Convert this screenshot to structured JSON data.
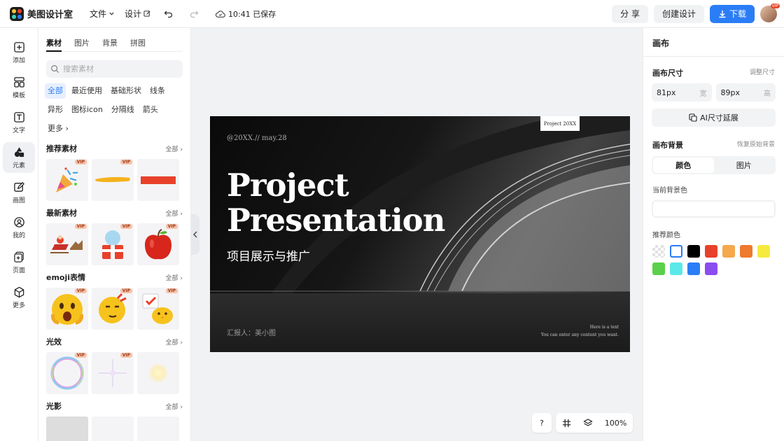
{
  "app": {
    "name": "美图设计室"
  },
  "topbar": {
    "file_label": "文件",
    "design_label": "设计",
    "save_status": "10:41 已保存",
    "share_label": "分 享",
    "create_label": "创建设计",
    "download_label": "下载",
    "avatar_badge": "VIP"
  },
  "leftnav": {
    "items": [
      {
        "label": "添加",
        "icon": "plus-square-icon"
      },
      {
        "label": "模板",
        "icon": "layout-icon"
      },
      {
        "label": "文字",
        "icon": "text-icon"
      },
      {
        "label": "元素",
        "icon": "shapes-icon"
      },
      {
        "label": "画图",
        "icon": "pencil-icon"
      },
      {
        "label": "我的",
        "icon": "user-icon"
      },
      {
        "label": "页面",
        "icon": "page-add-icon"
      },
      {
        "label": "更多",
        "icon": "cube-icon"
      }
    ],
    "active_index": 3
  },
  "panel": {
    "tabs": [
      "素材",
      "图片",
      "背景",
      "拼图"
    ],
    "active_tab": 0,
    "search_placeholder": "搜索素材",
    "chips": [
      "全部",
      "最近使用",
      "基础形状",
      "线条",
      "异形",
      "图标icon",
      "分隔线",
      "箭头",
      "更多"
    ],
    "active_chip": 0,
    "sections": [
      {
        "title": "推荐素材",
        "all": "全部"
      },
      {
        "title": "最新素材",
        "all": "全部"
      },
      {
        "title": "emoji表情",
        "all": "全部"
      },
      {
        "title": "光效",
        "all": "全部"
      },
      {
        "title": "光影",
        "all": "全部"
      }
    ],
    "vip_label": "VIP"
  },
  "slide": {
    "date": "@20XX.// may.28",
    "badge": "Project 20XX",
    "title_line1": "Project",
    "title_line2": "Presentation",
    "subtitle": "项目展示与推广",
    "reporter": "汇报人：美小图",
    "note_line1": "Here is a text",
    "note_line2": "You can enter any content you want."
  },
  "zoom": {
    "help": "?",
    "level": "100%"
  },
  "right": {
    "title": "画布",
    "size_label": "画布尺寸",
    "resize_link": "调整尺寸",
    "width_value": "81px",
    "width_unit": "宽",
    "height_value": "89px",
    "height_unit": "高",
    "ai_button": "AI尺寸延展",
    "bg_label": "画布背景",
    "restore_link": "恢复原始背景",
    "seg_color": "颜色",
    "seg_image": "图片",
    "current_bg_label": "当前背景色",
    "recommend_label": "推荐颜色",
    "swatches": [
      "transparent",
      "#ffffff",
      "#000000",
      "#e8412b",
      "#f5a84c",
      "#ef7a2c",
      "#f7ea3e",
      "#5bd04a",
      "#5be8e8",
      "#2b7df6",
      "#8b4cf0"
    ]
  }
}
